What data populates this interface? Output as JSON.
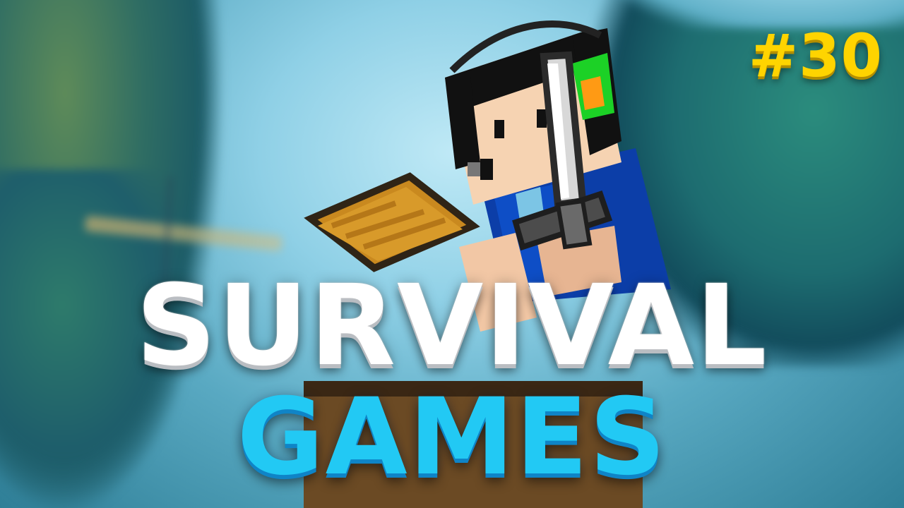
{
  "thumbnail": {
    "title_line_1": "SURVIVAL",
    "title_line_2": "GAMES",
    "episode": "#30"
  },
  "colors": {
    "title_line_1": "#ffffff",
    "title_line_2": "#22c9f4",
    "episode": "#ffd400",
    "sky": "#8fd0e6",
    "foliage": "#1d6c70"
  },
  "elements": {
    "character": "minecraft-player-with-iron-sword-and-headphones",
    "prop": "wooden-chest"
  }
}
